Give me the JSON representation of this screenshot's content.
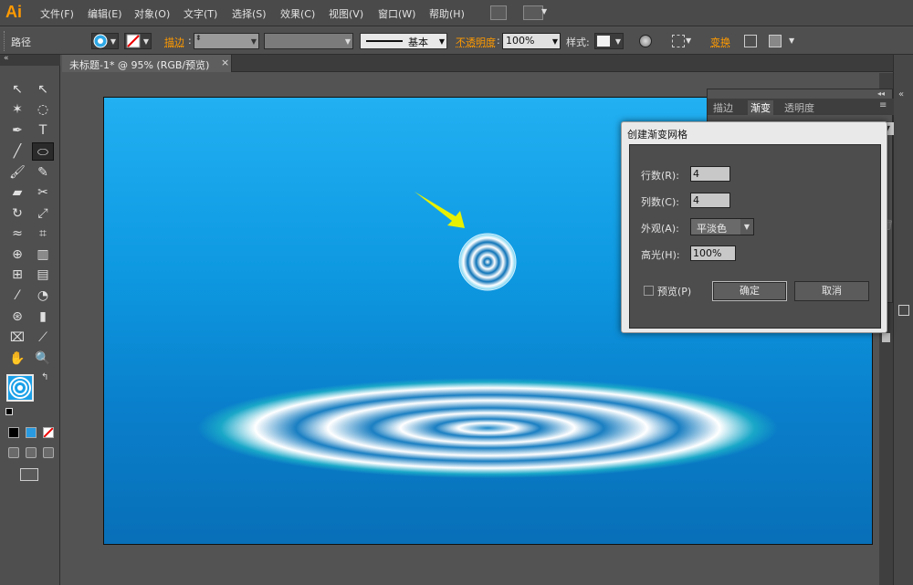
{
  "app": {
    "logo": "Ai"
  },
  "menu": {
    "items": [
      "文件(F)",
      "编辑(E)",
      "对象(O)",
      "文字(T)",
      "选择(S)",
      "效果(C)",
      "视图(V)",
      "窗口(W)",
      "帮助(H)"
    ]
  },
  "control_bar": {
    "object_type": "路径",
    "stroke_label": "描边",
    "stroke_style": "基本",
    "opacity_label": "不透明度",
    "opacity_value": "100%",
    "style_label": "样式:",
    "transform_label": "变换"
  },
  "document": {
    "tab_title": "未标题-1* @ 95% (RGB/预览)",
    "close_glyph": "×"
  },
  "gradient_panel": {
    "tabs": [
      "描边",
      "渐变",
      "透明度"
    ]
  },
  "dialog": {
    "title": "创建渐变网格",
    "rows_label": "行数(R):",
    "rows_value": "4",
    "cols_label": "列数(C):",
    "cols_value": "4",
    "appearance_label": "外观(A):",
    "appearance_value": "平淡色",
    "highlight_label": "高光(H):",
    "highlight_value": "100%",
    "preview_label": "预览(P)",
    "ok_label": "确定",
    "cancel_label": "取消"
  },
  "colors": {
    "accent_orange": "#ff9a00",
    "artboard_top": "#22b0f2",
    "artboard_bottom": "#086fb8",
    "arrow": "#e8f000"
  }
}
